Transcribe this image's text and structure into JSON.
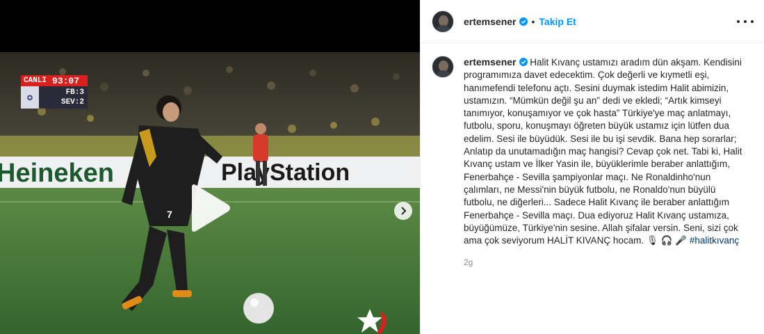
{
  "video": {
    "scorebug": {
      "live_label": "CANLI",
      "clock": "93:07",
      "home_team": "FB",
      "home_score": "3",
      "away_team": "SEV",
      "away_score": "2"
    },
    "ad_left": "Heineken",
    "ad_right": "PlayStation",
    "player_number": "7",
    "icons": [
      "play-icon",
      "chevron-right-icon",
      "channel-star-logo"
    ]
  },
  "post": {
    "username": "ertemsener",
    "verified": true,
    "follow_label": "Takip Et",
    "separator": "•",
    "caption": "Halit Kıvanç ustamızı aradım dün akşam. Kendisini programımıza davet edecektim. Çok değerli ve kıymetli eşi, hanımefendi telefonu açtı. Sesini duymak istedim Halit abimizin, ustamızın. “Mümkün değil şu an” dedi ve ekledi; “Artık kimseyi tanımıyor, konuşamıyor ve çok hasta” Türkiye'ye maç anlatmayı, futbolu, sporu, konuşmayı öğreten büyük ustamız için lütfen dua edelim. Sesi ile büyüdük. Sesi ile bu işi sevdik. Bana hep sorarlar; Anlatıp da unutamadığın maç hangisi? Cevap çok net. Tabi ki, Halit Kıvanç ustam ve İlker Yasin ile, büyüklerimle beraber anlattığım, Fenerbahçe - Sevilla şampiyonlar maçı. Ne Ronaldinho'nun çalımları, ne Messi'nin büyük futbolu, ne Ronaldo'nun büyülü futbolu, ne diğerleri... Sadece Halit Kıvanç ile beraber anlattığım Fenerbahçe - Sevilla maçı. Dua ediyoruz Halit Kıvanç ustamıza, büyüğümüze, Türkiye'nin sesine. Allah şifalar versin. Seni, sizi çok ama çok seviyorum HALİT KIVANÇ hocam. 🎙 🎧 🎤",
    "hashtag": "#halitkıvanç",
    "timestamp": "2g"
  },
  "colors": {
    "accent": "#0095f6",
    "hashtag": "#00376b",
    "text": "#262626",
    "muted": "#8e8e8e",
    "pitch": "#3f7a3a"
  }
}
